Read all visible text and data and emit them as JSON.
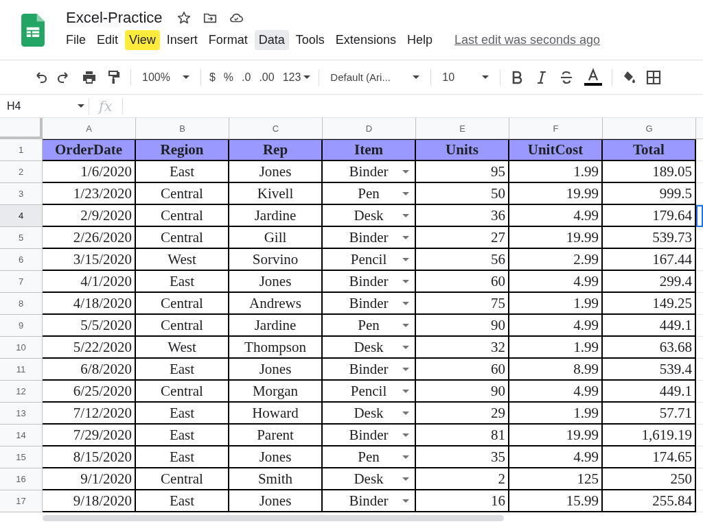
{
  "document": {
    "title": "Excel-Practice"
  },
  "menu": [
    {
      "label": "File",
      "highlighted": false,
      "hovered": false
    },
    {
      "label": "Edit",
      "highlighted": false,
      "hovered": false
    },
    {
      "label": "View",
      "highlighted": true,
      "hovered": false
    },
    {
      "label": "Insert",
      "highlighted": false,
      "hovered": false
    },
    {
      "label": "Format",
      "highlighted": false,
      "hovered": false
    },
    {
      "label": "Data",
      "highlighted": false,
      "hovered": true
    },
    {
      "label": "Tools",
      "highlighted": false,
      "hovered": false
    },
    {
      "label": "Extensions",
      "highlighted": false,
      "hovered": false
    },
    {
      "label": "Help",
      "highlighted": false,
      "hovered": false
    }
  ],
  "last_edit": "Last edit was seconds ago",
  "toolbar": {
    "zoom": "100%",
    "currency": "$",
    "percent": "%",
    "decrease_decimal": ".0",
    "increase_decimal": ".00",
    "number_format": "123",
    "font": "Default (Ari...",
    "font_size": "10"
  },
  "name_box": "H4",
  "formula_icon": "fx",
  "columns": [
    {
      "letter": "A",
      "dropdown": false
    },
    {
      "letter": "B",
      "dropdown": false
    },
    {
      "letter": "C",
      "dropdown": false
    },
    {
      "letter": "D",
      "dropdown": true
    },
    {
      "letter": "E",
      "dropdown": false
    },
    {
      "letter": "F",
      "dropdown": false
    },
    {
      "letter": "G",
      "dropdown": false
    }
  ],
  "header_row": {
    "number": "1",
    "cells": [
      "OrderDate",
      "Region",
      "Rep",
      "Item",
      "Units",
      "UnitCost",
      "Total"
    ]
  },
  "rows": [
    {
      "number": "2",
      "selected": false,
      "cells": [
        "1/6/2020",
        "East",
        "Jones",
        "Binder",
        "95",
        "1.99",
        "189.05"
      ]
    },
    {
      "number": "3",
      "selected": false,
      "cells": [
        "1/23/2020",
        "Central",
        "Kivell",
        "Pen",
        "50",
        "19.99",
        "999.5"
      ]
    },
    {
      "number": "4",
      "selected": true,
      "cells": [
        "2/9/2020",
        "Central",
        "Jardine",
        "Desk",
        "36",
        "4.99",
        "179.64"
      ]
    },
    {
      "number": "5",
      "selected": false,
      "cells": [
        "2/26/2020",
        "Central",
        "Gill",
        "Binder",
        "27",
        "19.99",
        "539.73"
      ]
    },
    {
      "number": "6",
      "selected": false,
      "cells": [
        "3/15/2020",
        "West",
        "Sorvino",
        "Pencil",
        "56",
        "2.99",
        "167.44"
      ]
    },
    {
      "number": "7",
      "selected": false,
      "cells": [
        "4/1/2020",
        "East",
        "Jones",
        "Binder",
        "60",
        "4.99",
        "299.4"
      ]
    },
    {
      "number": "8",
      "selected": false,
      "cells": [
        "4/18/2020",
        "Central",
        "Andrews",
        "Binder",
        "75",
        "1.99",
        "149.25"
      ]
    },
    {
      "number": "9",
      "selected": false,
      "cells": [
        "5/5/2020",
        "Central",
        "Jardine",
        "Pen",
        "90",
        "4.99",
        "449.1"
      ]
    },
    {
      "number": "10",
      "selected": false,
      "cells": [
        "5/22/2020",
        "West",
        "Thompson",
        "Desk",
        "32",
        "1.99",
        "63.68"
      ]
    },
    {
      "number": "11",
      "selected": false,
      "cells": [
        "6/8/2020",
        "East",
        "Jones",
        "Binder",
        "60",
        "8.99",
        "539.4"
      ]
    },
    {
      "number": "12",
      "selected": false,
      "cells": [
        "6/25/2020",
        "Central",
        "Morgan",
        "Pencil",
        "90",
        "4.99",
        "449.1"
      ]
    },
    {
      "number": "13",
      "selected": false,
      "cells": [
        "7/12/2020",
        "East",
        "Howard",
        "Desk",
        "29",
        "1.99",
        "57.71"
      ]
    },
    {
      "number": "14",
      "selected": false,
      "cells": [
        "7/29/2020",
        "East",
        "Parent",
        "Binder",
        "81",
        "19.99",
        "1,619.19"
      ]
    },
    {
      "number": "15",
      "selected": false,
      "cells": [
        "8/15/2020",
        "East",
        "Jones",
        "Pen",
        "35",
        "4.99",
        "174.65"
      ]
    },
    {
      "number": "16",
      "selected": false,
      "cells": [
        "9/1/2020",
        "Central",
        "Smith",
        "Desk",
        "2",
        "125",
        "250"
      ]
    },
    {
      "number": "17",
      "selected": false,
      "cells": [
        "9/18/2020",
        "East",
        "Jones",
        "Binder",
        "16",
        "15.99",
        "255.84"
      ]
    }
  ]
}
